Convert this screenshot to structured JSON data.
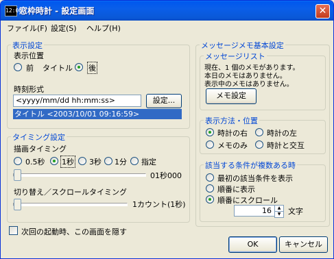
{
  "window": {
    "title": "窓枠時計 - 設定画面",
    "app_icon_text": "12:00",
    "close_glyph": "✕"
  },
  "menu": [
    {
      "label": "ファイル(F)"
    },
    {
      "label": "設定(S)"
    },
    {
      "label": "ヘルプ(H)"
    }
  ],
  "display": {
    "group_title": "表示設定",
    "position_label": "表示位置",
    "radio_front": "前",
    "title_label": "タイトル",
    "radio_back": "後",
    "selected_position": "後",
    "format_label": "時刻形式",
    "format_value": "<yyyy/mm/dd hh:mm:ss>",
    "format_button": "設定...",
    "preview": "タイトル <2003/10/01 09:16:59>"
  },
  "timing": {
    "group_title": "タイミング設定",
    "draw_label": "描画タイミング",
    "options": [
      "0.5秒",
      "1秒",
      "3秒",
      "1分",
      "指定"
    ],
    "selected": "1秒",
    "draw_value": "01秒000",
    "switch_label": "切り替え／スクロールタイミング",
    "switch_value": "1カウント(1秒)"
  },
  "hide_checkbox_label": "次回の起動時、この画面を隠す",
  "memo": {
    "group_title": "メッセージメモ基本設定",
    "list_title": "メッセージリスト",
    "list_lines": [
      "現在、1 個のメモがあります。",
      "本日のメモはありません。",
      "表示中のメモはありません。"
    ],
    "memo_button": "メモ設定"
  },
  "method": {
    "group_title": "表示方法・位置",
    "options": [
      "時計の右",
      "時計の左",
      "メモのみ",
      "時計と交互"
    ],
    "selected": "時計の右"
  },
  "conditions": {
    "group_title": "該当する条件が複数ある時",
    "options": [
      "最初の該当条件を表示",
      "順番に表示",
      "順番にスクロール"
    ],
    "selected": "順番にスクロール",
    "char_count": "16",
    "char_unit": "文字"
  },
  "buttons": {
    "ok": "OK",
    "cancel": "キャンセル"
  },
  "colors": {
    "title_bar": "#0058ee",
    "accent_label": "#0046d5",
    "selection": "#316ac5",
    "close": "#c23b1c"
  }
}
